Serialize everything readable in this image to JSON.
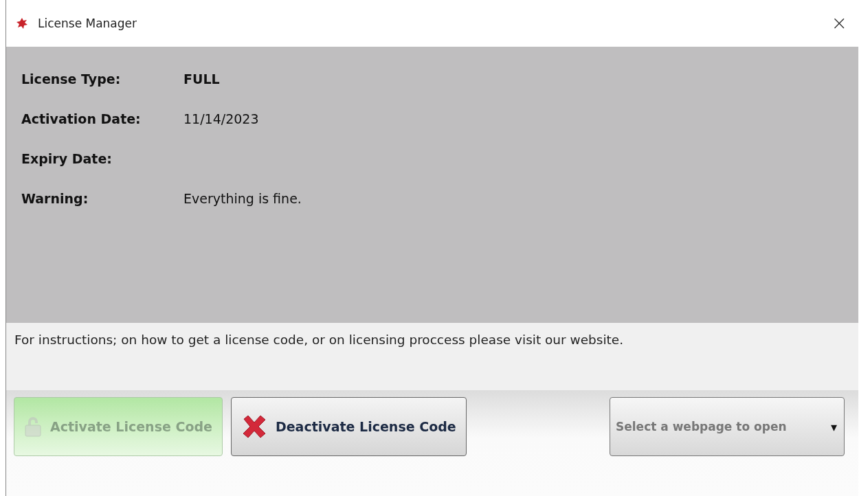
{
  "window": {
    "title": "License Manager",
    "close": "×"
  },
  "fields": [
    {
      "label": "License Type:",
      "value": "FULL",
      "bold": true
    },
    {
      "label": "Activation Date:",
      "value": "11/14/2023",
      "bold": false
    },
    {
      "label": "Expiry Date:"
    },
    {
      "label": "Warning:",
      "value": "Everything is fine.",
      "bold": false
    }
  ],
  "info": "For instructions; on how to get a license code, or on licensing proccess please visit our website.",
  "buttons": [
    {
      "kind": "activate",
      "label": "Activate License Code",
      "disabled": true
    },
    {
      "kind": "deactivate",
      "label": "Deactivate License Code",
      "disabled": false
    }
  ],
  "webpage_select": {
    "placeholder": "Select a webpage to open",
    "caret": "▾"
  }
}
